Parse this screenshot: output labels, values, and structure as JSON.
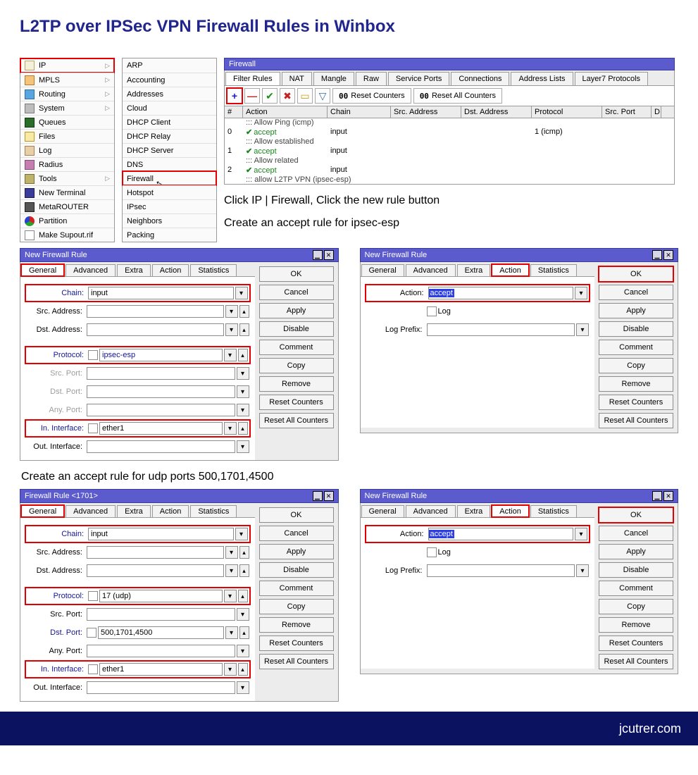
{
  "page_heading": "L2TP over IPSec VPN Firewall Rules in Winbox",
  "footer": "jcutrer.com",
  "sidebar": {
    "items": [
      {
        "label": "IP",
        "icon": "ip",
        "has_sub": true,
        "highlighted": true
      },
      {
        "label": "MPLS",
        "icon": "mpls",
        "has_sub": true
      },
      {
        "label": "Routing",
        "icon": "routing",
        "has_sub": true
      },
      {
        "label": "System",
        "icon": "system",
        "has_sub": true
      },
      {
        "label": "Queues",
        "icon": "queues"
      },
      {
        "label": "Files",
        "icon": "files"
      },
      {
        "label": "Log",
        "icon": "log"
      },
      {
        "label": "Radius",
        "icon": "radius"
      },
      {
        "label": "Tools",
        "icon": "tools",
        "has_sub": true
      },
      {
        "label": "New Terminal",
        "icon": "newterm"
      },
      {
        "label": "MetaROUTER",
        "icon": "meta"
      },
      {
        "label": "Partition",
        "icon": "part"
      },
      {
        "label": "Make Supout.rif",
        "icon": "supout"
      }
    ]
  },
  "submenu": {
    "items": [
      {
        "label": "ARP"
      },
      {
        "label": "Accounting"
      },
      {
        "label": "Addresses"
      },
      {
        "label": "Cloud"
      },
      {
        "label": "DHCP Client"
      },
      {
        "label": "DHCP Relay"
      },
      {
        "label": "DHCP Server"
      },
      {
        "label": "DNS"
      },
      {
        "label": "Firewall",
        "highlighted": true,
        "has_cursor": true
      },
      {
        "label": "Hotspot"
      },
      {
        "label": "IPsec"
      },
      {
        "label": "Neighbors"
      },
      {
        "label": "Packing"
      }
    ]
  },
  "firewall_window": {
    "title": "Firewall",
    "tabs": [
      "Filter Rules",
      "NAT",
      "Mangle",
      "Raw",
      "Service Ports",
      "Connections",
      "Address Lists",
      "Layer7 Protocols"
    ],
    "active_tab": 0,
    "toolbar": {
      "reset_counters": "Reset Counters",
      "reset_all_counters": "Reset All Counters"
    },
    "columns": [
      "#",
      "Action",
      "Chain",
      "Src. Address",
      "Dst. Address",
      "Protocol",
      "Src. Port",
      "D"
    ],
    "rows": [
      {
        "comment": "::: Allow Ping (icmp)"
      },
      {
        "num": "0",
        "action": "accept",
        "chain": "input",
        "protocol": "1 (icmp)"
      },
      {
        "comment": "::: Allow established"
      },
      {
        "num": "1",
        "action": "accept",
        "chain": "input"
      },
      {
        "comment": "::: Allow related"
      },
      {
        "num": "2",
        "action": "accept",
        "chain": "input"
      },
      {
        "comment": "::: allow L2TP VPN (ipsec-esp)"
      }
    ]
  },
  "caption1": "Click IP | Firewall,  Click the new rule button",
  "caption2": "Create an accept rule for ipsec-esp",
  "caption3": "Create an accept rule for udp ports 500,1701,4500",
  "dialog_labels": {
    "chain": "Chain:",
    "src_addr": "Src. Address:",
    "dst_addr": "Dst. Address:",
    "protocol": "Protocol:",
    "src_port": "Src. Port:",
    "dst_port": "Dst. Port:",
    "any_port": "Any. Port:",
    "in_iface": "In. Interface:",
    "out_iface": "Out. Interface:",
    "action": "Action:",
    "log": "Log",
    "log_prefix": "Log Prefix:"
  },
  "dialog_tabs": [
    "General",
    "Advanced",
    "Extra",
    "Action",
    "Statistics"
  ],
  "dialog_buttons": {
    "ok": "OK",
    "cancel": "Cancel",
    "apply": "Apply",
    "disable": "Disable",
    "comment": "Comment",
    "copy": "Copy",
    "remove": "Remove",
    "reset_counters": "Reset Counters",
    "reset_all": "Reset All Counters"
  },
  "dialog1": {
    "title": "New Firewall Rule",
    "chain": "input",
    "protocol": "ipsec-esp",
    "in_iface": "ether1"
  },
  "dialog2": {
    "title": "New Firewall Rule",
    "action_value": "accept"
  },
  "dialog3": {
    "title": "Firewall Rule <1701>",
    "chain": "input",
    "protocol": "17 (udp)",
    "dst_port": "500,1701,4500",
    "in_iface": "ether1"
  },
  "dialog4": {
    "title": "New Firewall Rule",
    "action_value": "accept"
  }
}
